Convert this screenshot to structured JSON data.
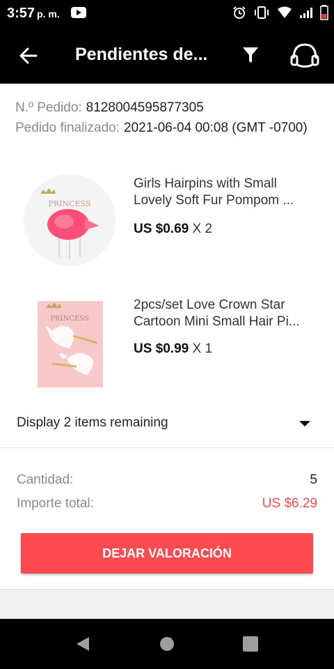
{
  "status_bar": {
    "time": "3:57",
    "ampm": "p. m.",
    "icons": [
      "youtube-icon",
      "alarm-icon",
      "vibrate-icon",
      "wifi-icon",
      "signal-icon",
      "battery-icon"
    ]
  },
  "app_bar": {
    "title": "Pendientes de...",
    "icons": [
      "back-arrow-icon",
      "filter-icon",
      "headset-support-icon"
    ]
  },
  "order": {
    "number_label": "N.º Pedido:",
    "number_value": "8128004595877305",
    "finalized_label": "Pedido finalizado:",
    "finalized_value": "2021-06-04 00:08 (GMT -0700)"
  },
  "items": [
    {
      "title_line1": "Girls Hairpins with Small",
      "title_line2": "Lovely Soft Fur Pompom ...",
      "price": "US $0.69",
      "qty": "X 2",
      "thumb_text": "PRINCESS"
    },
    {
      "title_line1": "2pcs/set Love Crown Star",
      "title_line2": "Cartoon Mini Small Hair Pi...",
      "price": "US $0.99",
      "qty": "X 1",
      "thumb_text": "PRINCESS"
    }
  ],
  "display_remaining": "Display 2 items remaining",
  "summary": {
    "quantity_label": "Cantidad:",
    "quantity_value": "5",
    "total_label": "Importe total:",
    "total_value": "US $6.29"
  },
  "review_button": "DEJAR VALORACIÓN",
  "colors": {
    "accent": "#fd4b4f",
    "price_red": "#f44a4a",
    "bar": "#000000"
  }
}
